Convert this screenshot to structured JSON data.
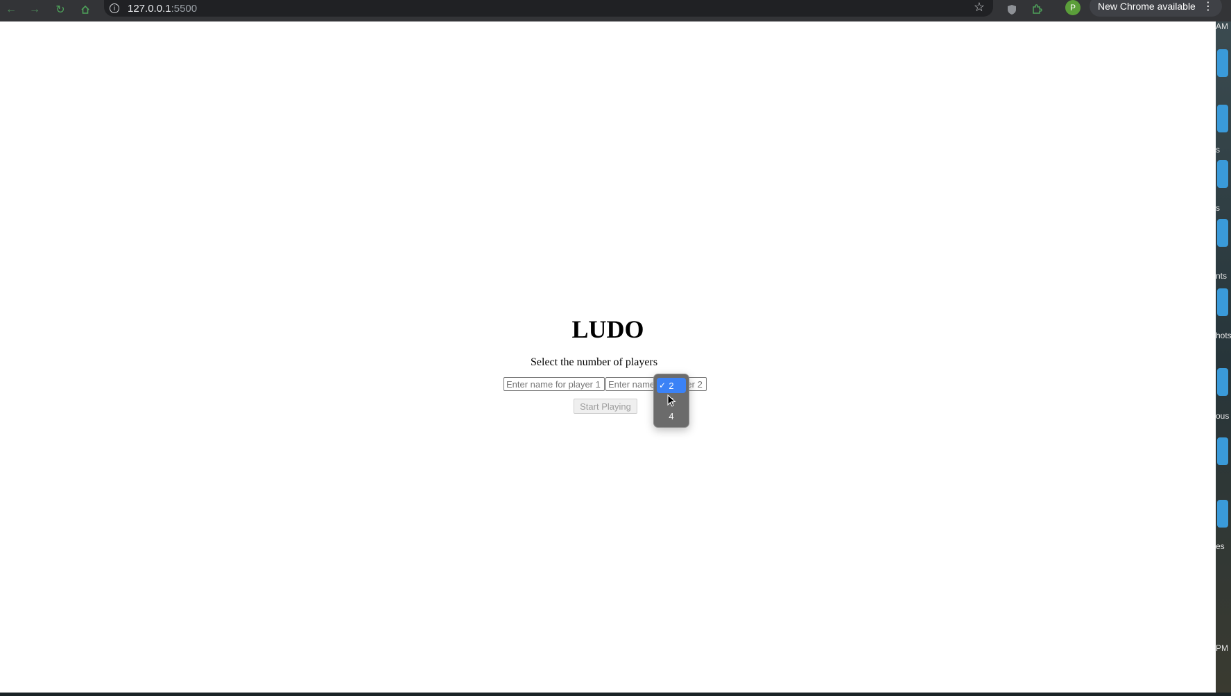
{
  "browser": {
    "url_host": "127.0.0.1",
    "url_port": ":5500",
    "profile_initial": "P",
    "update_label": "New Chrome available"
  },
  "desktop": {
    "labels": [
      "AM",
      "s",
      "s",
      "nts",
      "hots",
      "ous",
      "es",
      "PM"
    ]
  },
  "page": {
    "title": "LUDO",
    "select_label": "Select the number of players",
    "player_inputs": [
      {
        "placeholder": "Enter name for player 1",
        "value": ""
      },
      {
        "placeholder": "Enter name for player 2",
        "value": ""
      }
    ],
    "start_button_label": "Start Playing",
    "start_button_enabled": false
  },
  "player_count_dropdown": {
    "options": [
      "2",
      "3",
      "4"
    ],
    "selected": "2",
    "check_mark": "✓"
  }
}
